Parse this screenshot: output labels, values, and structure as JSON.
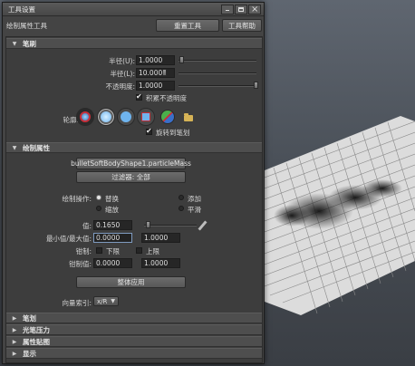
{
  "window": {
    "title": "工具设置",
    "tool_name": "绘制属性工具",
    "reset_label": "重置工具",
    "help_label": "工具帮助"
  },
  "brush": {
    "header": "笔刷",
    "radius_u_label": "半径(U):",
    "radius_u_value": "1.0000",
    "radius_l_label": "半径(L):",
    "radius_l_value": "10.0000",
    "opacity_label": "不透明度:",
    "opacity_value": "1.0000",
    "accumulate_label": "积累不透明度",
    "profile_label": "轮廓:",
    "rotate_label": "旋转到笔划"
  },
  "paint_attrs": {
    "header": "绘制属性",
    "node_button": "bulletSoftBodyShape1.particleMass",
    "filter_button": "过滤器: 全部",
    "operation_label": "绘制操作:",
    "op_replace": "替换",
    "op_add": "添加",
    "op_scale": "缩放",
    "op_smooth": "平滑",
    "value_label": "值:",
    "value": "0.1650",
    "minmax_label": "最小值/最大值:",
    "min_value": "0.0000",
    "max_value": "1.0000",
    "clamp_label": "钳制:",
    "clamp_lower": "下限",
    "clamp_upper": "上限",
    "clamp_values_label": "钳制值:",
    "clamp_min": "0.0000",
    "clamp_max": "1.0000",
    "flood_button": "整体应用",
    "vector_index_label": "向量索引:",
    "vector_index_value": "x/R"
  },
  "collapsed_sections": [
    "笔划",
    "光笔压力",
    "属性贴图",
    "显示"
  ],
  "colors": {
    "panel_bg": "#444444",
    "section_bg": "#4e4e4e",
    "field_bg": "#262626",
    "accent_red": "#c8303a",
    "accent_blue": "#6fb4ee"
  }
}
